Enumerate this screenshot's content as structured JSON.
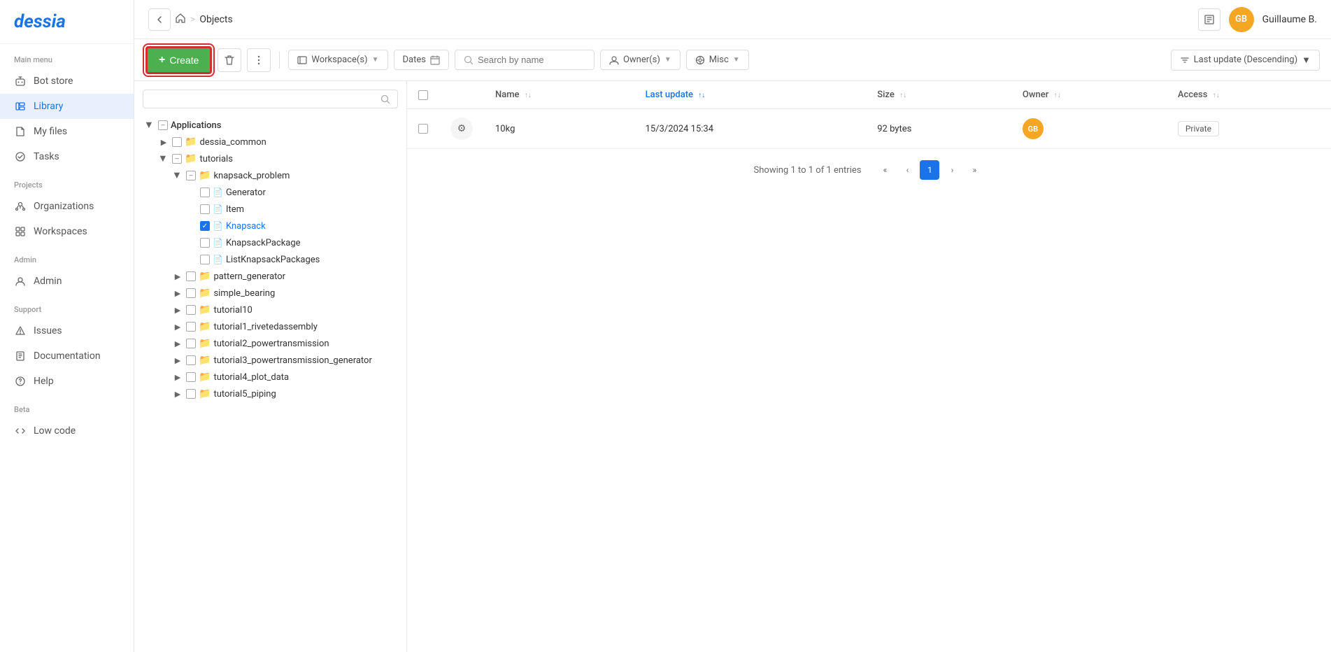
{
  "app": {
    "logo": "dessia",
    "topbar": {
      "home_label": "home",
      "separator": ">",
      "page": "Objects",
      "username": "Guillaume B.",
      "avatar_initials": "GB"
    }
  },
  "sidebar": {
    "main_menu_label": "Main menu",
    "items": [
      {
        "id": "bot-store",
        "label": "Bot store",
        "icon": "bot"
      },
      {
        "id": "library",
        "label": "Library",
        "icon": "library",
        "active": true
      },
      {
        "id": "my-files",
        "label": "My files",
        "icon": "files"
      },
      {
        "id": "tasks",
        "label": "Tasks",
        "icon": "tasks"
      }
    ],
    "projects_label": "Projects",
    "projects_items": [
      {
        "id": "organizations",
        "label": "Organizations",
        "icon": "org"
      },
      {
        "id": "workspaces",
        "label": "Workspaces",
        "icon": "workspace"
      }
    ],
    "admin_label": "Admin",
    "admin_items": [
      {
        "id": "admin",
        "label": "Admin",
        "icon": "admin"
      }
    ],
    "support_label": "Support",
    "support_items": [
      {
        "id": "issues",
        "label": "Issues",
        "icon": "issues"
      },
      {
        "id": "documentation",
        "label": "Documentation",
        "icon": "docs"
      },
      {
        "id": "help",
        "label": "Help",
        "icon": "help"
      }
    ],
    "beta_label": "Beta",
    "beta_items": [
      {
        "id": "low-code",
        "label": "Low code",
        "icon": "code"
      }
    ]
  },
  "toolbar": {
    "create_label": "Create",
    "workspace_label": "Workspace(s)",
    "dates_label": "Dates",
    "search_placeholder": "Search by name",
    "owner_label": "Owner(s)",
    "misc_label": "Misc",
    "sort_label": "Last update (Descending)"
  },
  "tree": {
    "search_placeholder": "",
    "root": {
      "label": "Applications",
      "children": [
        {
          "label": "dessia_common",
          "type": "folder",
          "expanded": false
        },
        {
          "label": "tutorials",
          "type": "folder",
          "expanded": true,
          "children": [
            {
              "label": "knapsack_problem",
              "type": "folder",
              "expanded": true,
              "children": [
                {
                  "label": "Generator",
                  "type": "file"
                },
                {
                  "label": "Item",
                  "type": "file"
                },
                {
                  "label": "Knapsack",
                  "type": "file",
                  "selected": true
                },
                {
                  "label": "KnapsackPackage",
                  "type": "file"
                },
                {
                  "label": "ListKnapsackPackages",
                  "type": "file"
                }
              ]
            },
            {
              "label": "pattern_generator",
              "type": "folder",
              "expanded": false
            },
            {
              "label": "simple_bearing",
              "type": "folder",
              "expanded": false
            },
            {
              "label": "tutorial10",
              "type": "folder",
              "expanded": false
            },
            {
              "label": "tutorial1_rivetedassembly",
              "type": "folder",
              "expanded": false
            },
            {
              "label": "tutorial2_powertransmission",
              "type": "folder",
              "expanded": false
            },
            {
              "label": "tutorial3_powertransmission_generator",
              "type": "folder",
              "expanded": false
            },
            {
              "label": "tutorial4_plot_data",
              "type": "folder",
              "expanded": false
            },
            {
              "label": "tutorial5_piping",
              "type": "folder",
              "expanded": false
            }
          ]
        }
      ]
    }
  },
  "table": {
    "columns": [
      {
        "id": "name",
        "label": "Name",
        "sortable": true,
        "active": false
      },
      {
        "id": "last_update",
        "label": "Last update",
        "sortable": true,
        "active": true
      },
      {
        "id": "size",
        "label": "Size",
        "sortable": true,
        "active": false
      },
      {
        "id": "owner",
        "label": "Owner",
        "sortable": true,
        "active": false
      },
      {
        "id": "access",
        "label": "Access",
        "sortable": true,
        "active": false
      }
    ],
    "rows": [
      {
        "name": "10kg",
        "last_update": "15/3/2024 15:34",
        "size": "92 bytes",
        "owner_initials": "GB",
        "access": "Private"
      }
    ],
    "pagination": {
      "info": "Showing 1 to 1 of 1 entries",
      "current_page": 1,
      "total_pages": 1
    }
  }
}
